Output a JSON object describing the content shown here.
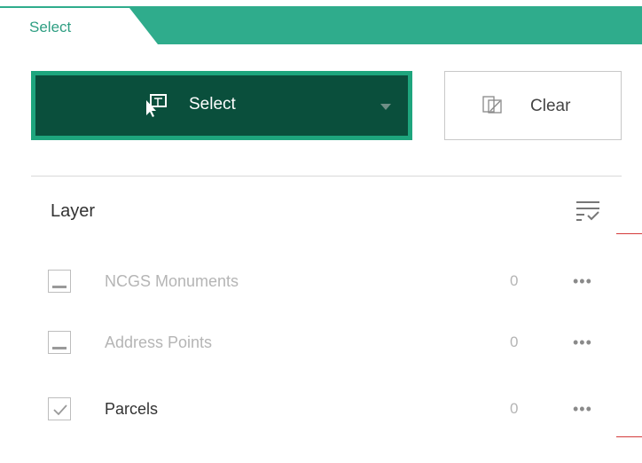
{
  "tab": {
    "label": "Select"
  },
  "toolbar": {
    "select_label": "Select",
    "clear_label": "Clear"
  },
  "layer_header": {
    "title": "Layer"
  },
  "layers": [
    {
      "name": "NCGS Monuments",
      "count": "0",
      "checked": false,
      "enabled": false
    },
    {
      "name": "Address Points",
      "count": "0",
      "checked": false,
      "enabled": false
    },
    {
      "name": "Parcels",
      "count": "0",
      "checked": true,
      "enabled": true
    }
  ],
  "icons": {
    "select": "select-cursor-icon",
    "dropdown": "chevron-down-icon",
    "clear": "clear-selection-icon",
    "filter": "filter-list-icon",
    "more": "ellipsis-icon"
  },
  "colors": {
    "accent": "#2fac8c",
    "button_dark": "#0a4f3c",
    "button_border": "#1ea57d"
  },
  "more_label": "•••"
}
